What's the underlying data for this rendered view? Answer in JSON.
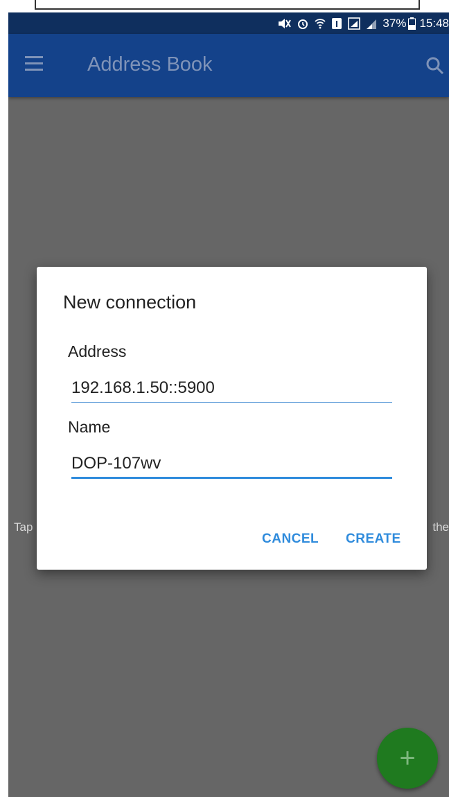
{
  "status_bar": {
    "battery_percent": "37%",
    "time": "15:48"
  },
  "app_bar": {
    "title": "Address Book",
    "menu_icon": "hamburger-menu-icon",
    "search_icon": "search-icon"
  },
  "background": {
    "hint_left_fragment": "Tap",
    "hint_right_fragment": "the"
  },
  "dialog": {
    "title": "New connection",
    "address_label": "Address",
    "address_value": "192.168.1.50::5900",
    "name_label": "Name",
    "name_value": "DOP-107wv",
    "cancel_label": "CANCEL",
    "create_label": "CREATE"
  },
  "fab": {
    "icon": "plus-icon",
    "symbol": "+"
  },
  "colors": {
    "status_bar": "#0f2f5e",
    "app_bar": "#14428a",
    "scrim": "#666666",
    "accent": "#2f8bdc",
    "fab": "#1f7a1f"
  }
}
